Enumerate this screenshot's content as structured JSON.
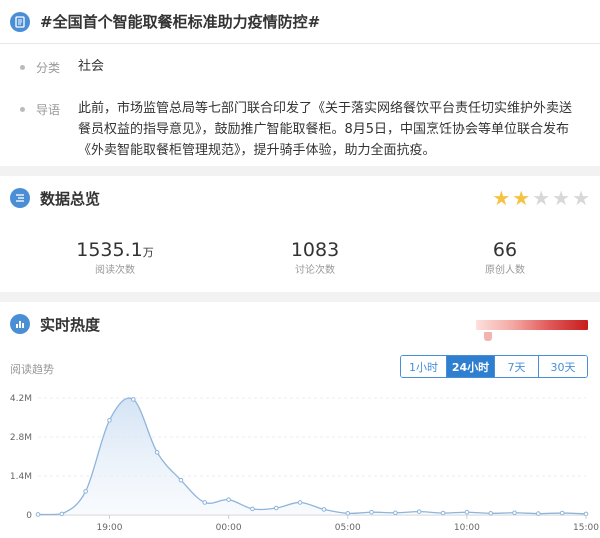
{
  "topic": {
    "title": "#全国首个智能取餐柜标准助力疫情防控#",
    "category_key": "分类",
    "category_value": "社会",
    "lead_key": "导语",
    "lead_value": "此前，市场监管总局等七部门联合印发了《关于落实网络餐饮平台责任切实维护外卖送餐员权益的指导意见》，鼓励推广智能取餐柜。8月5日，中国烹饪协会等单位联合发布《外卖智能取餐柜管理规范》，提升骑手体验，助力全面抗疫。"
  },
  "stats": {
    "title": "数据总览",
    "rating": 2,
    "rating_max": 5,
    "items": [
      {
        "value": "1535.1",
        "unit": "万",
        "label": "阅读次数"
      },
      {
        "value": "1083",
        "unit": "",
        "label": "讨论次数"
      },
      {
        "value": "66",
        "unit": "",
        "label": "原创人数"
      }
    ]
  },
  "heat": {
    "title": "实时热度",
    "trend_label": "阅读趋势",
    "level": 0.07,
    "ranges": [
      "1小时",
      "24小时",
      "7天",
      "30天"
    ],
    "active_range": "24小时"
  },
  "colors": {
    "accent": "#2f7fd1",
    "line": "#8fb4dc",
    "star_on": "#f5c342"
  },
  "chart_data": {
    "type": "area",
    "title": "",
    "xlabel": "",
    "ylabel": "",
    "ylim": [
      0,
      4.2
    ],
    "yticks": [
      0,
      1.4,
      2.8,
      4.2
    ],
    "ytick_labels": [
      "0",
      "1.4M",
      "2.8M",
      "4.2M"
    ],
    "x": [
      "16:00",
      "17:00",
      "18:00",
      "19:00",
      "20:00",
      "21:00",
      "22:00",
      "23:00",
      "00:00",
      "01:00",
      "02:00",
      "03:00",
      "04:00",
      "05:00",
      "06:00",
      "07:00",
      "08:00",
      "09:00",
      "10:00",
      "11:00",
      "12:00",
      "13:00",
      "14:00",
      "15:00"
    ],
    "xticks": [
      "19:00",
      "00:00",
      "05:00",
      "10:00",
      "15:00"
    ],
    "series": [
      {
        "values": [
          0.02,
          0.04,
          0.85,
          3.4,
          4.15,
          2.25,
          1.25,
          0.45,
          0.55,
          0.22,
          0.25,
          0.45,
          0.2,
          0.06,
          0.1,
          0.08,
          0.12,
          0.07,
          0.1,
          0.06,
          0.08,
          0.05,
          0.07,
          0.04
        ]
      }
    ],
    "grid": true,
    "legend": "none"
  }
}
